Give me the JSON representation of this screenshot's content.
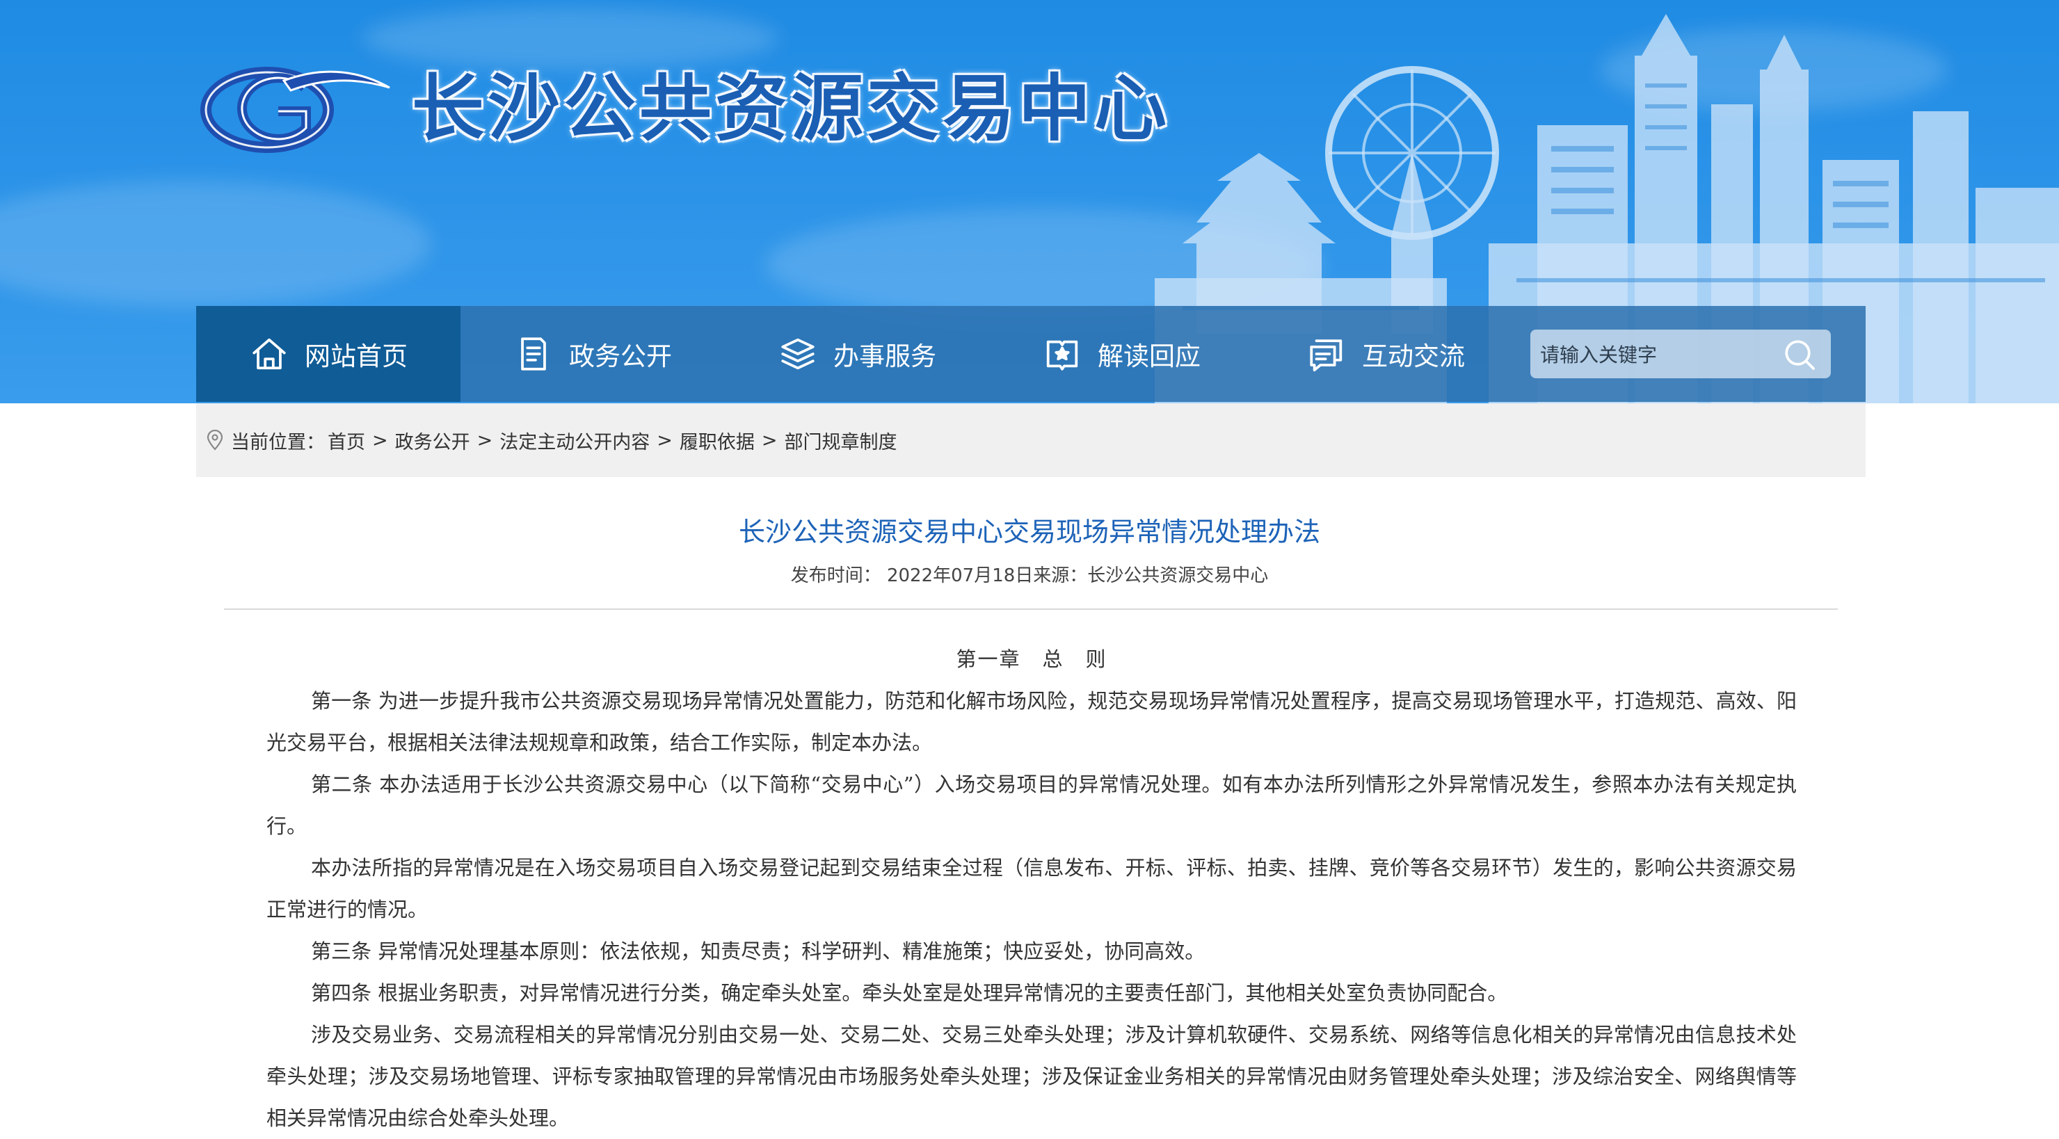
{
  "site": {
    "title": "长沙公共资源交易中心"
  },
  "nav": {
    "items": [
      {
        "label": "网站首页",
        "icon": "home-icon",
        "active": true
      },
      {
        "label": "政务公开",
        "icon": "document-icon",
        "active": false
      },
      {
        "label": "办事服务",
        "icon": "layers-icon",
        "active": false
      },
      {
        "label": "解读回应",
        "icon": "book-star-icon",
        "active": false
      },
      {
        "label": "互动交流",
        "icon": "chat-icon",
        "active": false
      }
    ],
    "search_placeholder": "请输入关键字"
  },
  "breadcrumb": {
    "label": "当前位置：",
    "items": [
      "首页",
      "政务公开",
      "法定主动公开内容",
      "履职依据",
      "部门规章制度"
    ],
    "separator": ">"
  },
  "article": {
    "title": "长沙公共资源交易中心交易现场异常情况处理办法",
    "meta": "发布时间：  2022年07月18日来源：长沙公共资源交易中心",
    "chapter": "第一章　总　则",
    "paragraphs": [
      "第一条  为进一步提升我市公共资源交易现场异常情况处置能力，防范和化解市场风险，规范交易现场异常情况处置程序，提高交易现场管理水平，打造规范、高效、阳光交易平台，根据相关法律法规规章和政策，结合工作实际，制定本办法。",
      "第二条  本办法适用于长沙公共资源交易中心（以下简称“交易中心”）入场交易项目的异常情况处理。如有本办法所列情形之外异常情况发生，参照本办法有关规定执行。",
      "本办法所指的异常情况是在入场交易项目自入场交易登记起到交易结束全过程（信息发布、开标、评标、拍卖、挂牌、竞价等各交易环节）发生的，影响公共资源交易正常进行的情况。",
      "第三条  异常情况处理基本原则：依法依规，知责尽责；科学研判、精准施策；快应妥处，协同高效。",
      "第四条  根据业务职责，对异常情况进行分类，确定牵头处室。牵头处室是处理异常情况的主要责任部门，其他相关处室负责协同配合。",
      "涉及交易业务、交易流程相关的异常情况分别由交易一处、交易二处、交易三处牵头处理；涉及计算机软硬件、交易系统、网络等信息化相关的异常情况由信息技术处牵头处理；涉及交易场地管理、评标专家抽取管理的异常情况由市场服务处牵头处理；涉及保证金业务相关的异常情况由财务管理处牵头处理；涉及综治安全、网络舆情等相关异常情况由综合处牵头处理。"
    ]
  },
  "colors": {
    "banner_blue": "#2b93e8",
    "nav_bg": "#2c71b0",
    "nav_active": "#0f5c97",
    "title_blue": "#1d63b8"
  }
}
